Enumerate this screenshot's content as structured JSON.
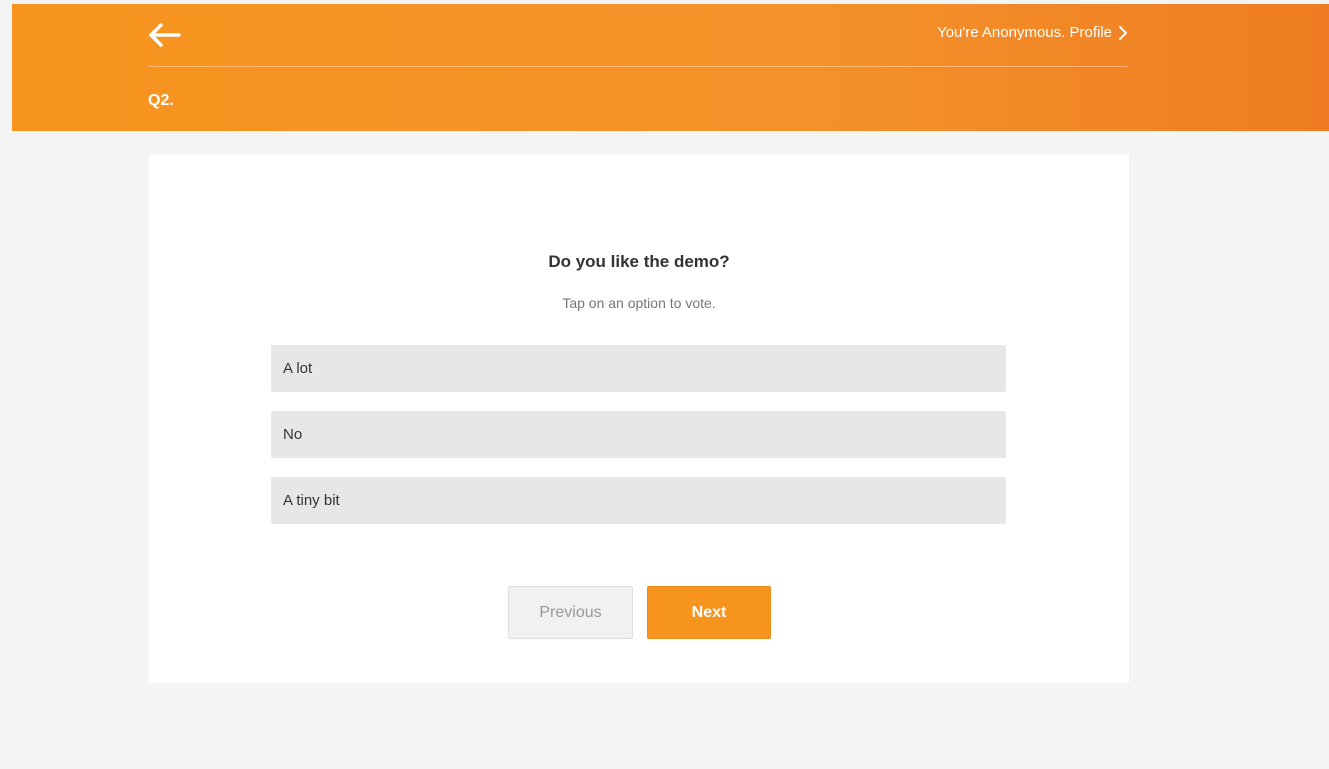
{
  "header": {
    "back_icon": "arrow-left-icon",
    "profile_label": "You're Anonymous. Profile",
    "profile_icon": "chevron-right-icon",
    "question_number": "Q2.",
    "color": "#f7941d"
  },
  "poll": {
    "question": "Do you like the demo?",
    "hint": "Tap on an option to vote.",
    "options": [
      {
        "label": "A lot"
      },
      {
        "label": "No"
      },
      {
        "label": "A tiny bit"
      }
    ]
  },
  "nav": {
    "previous_label": "Previous",
    "next_label": "Next",
    "next_color": "#f7941d"
  }
}
